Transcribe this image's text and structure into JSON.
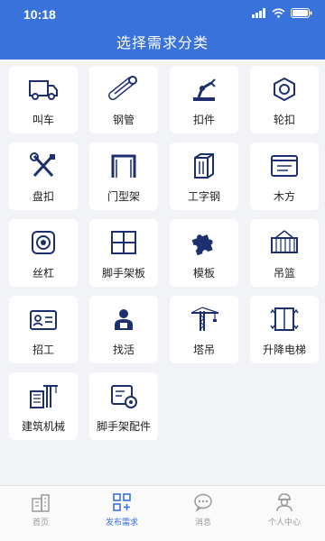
{
  "status_bar": {
    "time": "10:18"
  },
  "header": {
    "title": "选择需求分类"
  },
  "categories": [
    {
      "label": "叫车",
      "icon": "truck-icon"
    },
    {
      "label": "钢管",
      "icon": "steel-pipe-icon"
    },
    {
      "label": "扣件",
      "icon": "robot-arm-icon"
    },
    {
      "label": "轮扣",
      "icon": "hex-nut-icon"
    },
    {
      "label": "盘扣",
      "icon": "wrench-screwdriver-icon"
    },
    {
      "label": "门型架",
      "icon": "door-frame-icon"
    },
    {
      "label": "工字钢",
      "icon": "i-beam-icon"
    },
    {
      "label": "木方",
      "icon": "wood-panel-icon"
    },
    {
      "label": "丝杠",
      "icon": "screw-jack-icon"
    },
    {
      "label": "脚手架板",
      "icon": "scaffold-board-icon"
    },
    {
      "label": "模板",
      "icon": "puzzle-icon"
    },
    {
      "label": "吊篮",
      "icon": "gondola-icon"
    },
    {
      "label": "招工",
      "icon": "id-card-icon"
    },
    {
      "label": "找活",
      "icon": "worker-icon"
    },
    {
      "label": "塔吊",
      "icon": "tower-crane-icon"
    },
    {
      "label": "升降电梯",
      "icon": "elevator-icon"
    },
    {
      "label": "建筑机械",
      "icon": "construction-machine-icon"
    },
    {
      "label": "脚手架配件",
      "icon": "scaffold-parts-icon"
    }
  ],
  "tabbar": {
    "items": [
      {
        "label": "首页",
        "icon": "home-building-icon"
      },
      {
        "label": "发布需求",
        "icon": "publish-grid-icon"
      },
      {
        "label": "消息",
        "icon": "message-bubble-icon"
      },
      {
        "label": "个人中心",
        "icon": "profile-icon"
      }
    ],
    "active_index": 1,
    "active_color": "#3a72dc",
    "inactive_color": "#999999"
  },
  "colors": {
    "brand": "#3a72dc",
    "icon": "#1d2f6e",
    "background": "#f2f3f7"
  }
}
